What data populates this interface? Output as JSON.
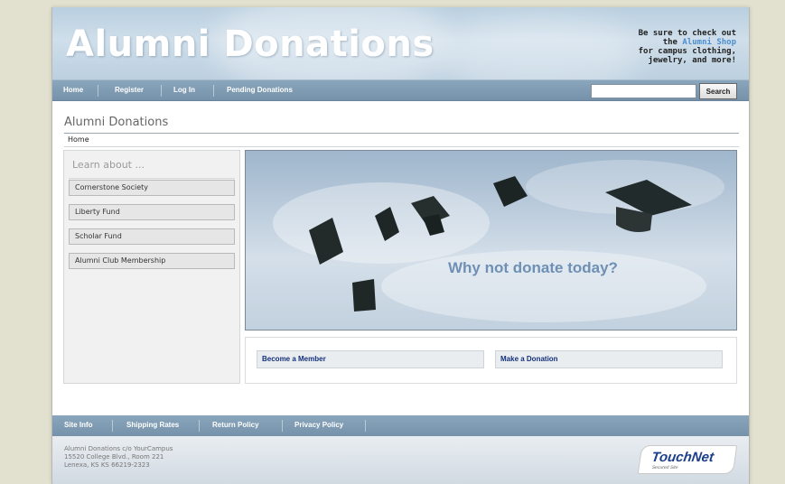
{
  "header": {
    "site_title": "Alumni Donations",
    "promo_line1": "Be sure to check out",
    "promo_the": "the",
    "promo_link": "Alumni Shop",
    "promo_line3": "for campus clothing,",
    "promo_line4": "jewelry, and more!"
  },
  "nav": {
    "items": [
      {
        "label": "Home"
      },
      {
        "label": "Register"
      },
      {
        "label": "Log In"
      },
      {
        "label": "Pending Donations"
      }
    ],
    "search_value": "",
    "search_button": "Search"
  },
  "main": {
    "page_title": "Alumni Donations",
    "breadcrumb": "Home",
    "sidebar": {
      "heading": "Learn about ...",
      "items": [
        {
          "label": "Cornerstone Society"
        },
        {
          "label": "Liberty Fund"
        },
        {
          "label": "Scholar Fund"
        },
        {
          "label": "Alumni Club Membership"
        }
      ]
    },
    "hero_text": "Why not donate today?",
    "actions": [
      {
        "label": "Become a Member"
      },
      {
        "label": "Make a Donation"
      }
    ]
  },
  "footer": {
    "links": [
      {
        "label": "Site Info"
      },
      {
        "label": "Shipping Rates"
      },
      {
        "label": "Return Policy"
      },
      {
        "label": "Privacy Policy"
      }
    ],
    "address_line1": "Alumni Donations c/o YourCampus",
    "address_line2": "15520 College Blvd., Room 221",
    "address_line3": "Lenexa, KS KS 66219-2323",
    "logo_name": "TouchNet",
    "logo_sub": "Secured Site"
  },
  "colors": {
    "nav_bar": "#7f9cb4",
    "header_sky": "#c4d6e6",
    "link_blue": "#14307a",
    "hero_text": "#6f90b4"
  }
}
